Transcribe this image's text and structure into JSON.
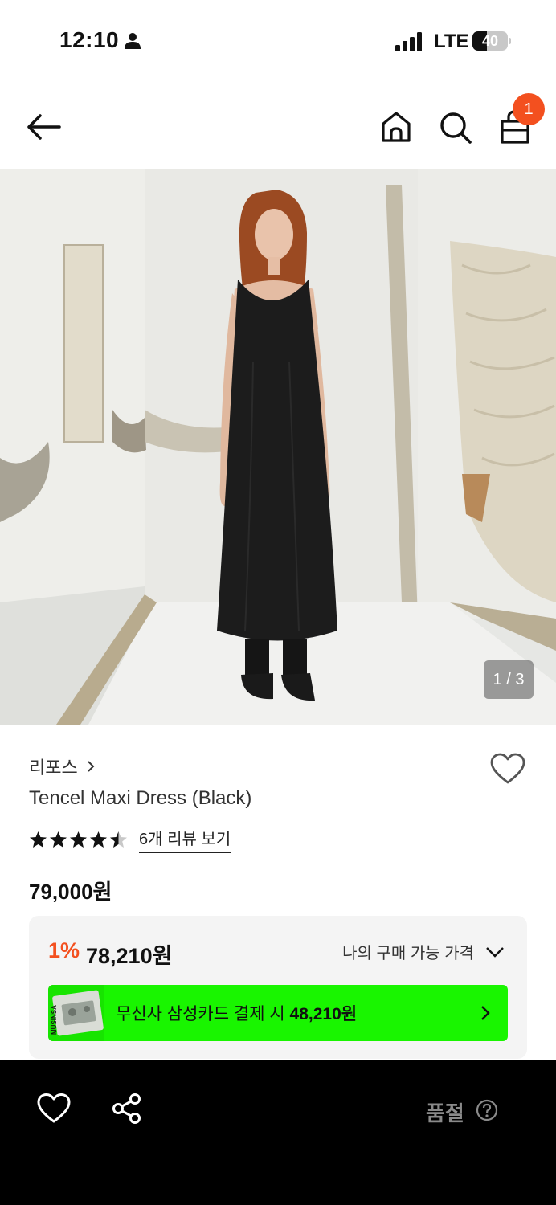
{
  "status_bar": {
    "time": "12:10",
    "network": "LTE",
    "battery": "40",
    "battery_level": 0.4
  },
  "header": {
    "cart_count": "1",
    "icons": [
      "back-arrow-icon",
      "home-icon",
      "search-icon",
      "shopping-bag-icon"
    ]
  },
  "gallery": {
    "counter": "1 / 3"
  },
  "product": {
    "brand": "리포스",
    "name": "Tencel Maxi Dress (Black)",
    "rating": 4.5,
    "review_link": "6개 리뷰 보기",
    "price": "79,000원"
  },
  "price_box": {
    "discount_rate": "1%",
    "discount_price": "78,210원",
    "my_price_label": "나의 구매 가능 가격",
    "card_logo_text": "MUSINSA",
    "card_offer_prefix": "무신사 삼성카드 결제 시 ",
    "card_offer_price": "48,210원",
    "banner_color": "#19f500"
  },
  "bottom_bar": {
    "status": "품절",
    "icons": [
      "heart-icon",
      "share-icon",
      "help-icon"
    ]
  },
  "colors": {
    "accent": "#f3501f",
    "banner_green": "#19f500",
    "bottom_bar": "#000000"
  }
}
